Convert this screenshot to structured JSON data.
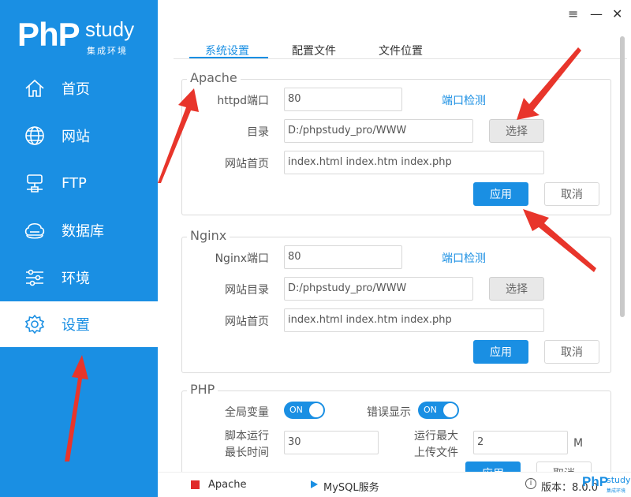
{
  "app": {
    "logo_php": "PhP",
    "logo_study": "study",
    "logo_tagline": "集成环境",
    "window_controls": {
      "menu": "≡",
      "minimize": "—",
      "close": "✕"
    }
  },
  "sidebar": {
    "items": [
      {
        "label": "首页",
        "icon": "home-icon"
      },
      {
        "label": "网站",
        "icon": "globe-icon"
      },
      {
        "label": "FTP",
        "icon": "ftp-icon"
      },
      {
        "label": "数据库",
        "icon": "database-icon"
      },
      {
        "label": "环境",
        "icon": "sliders-icon"
      },
      {
        "label": "设置",
        "icon": "gear-icon",
        "active": true
      }
    ]
  },
  "tabs": [
    "系统设置",
    "配置文件",
    "文件位置"
  ],
  "apache": {
    "title": "Apache",
    "port_label": "httpd端口",
    "port_value": "80",
    "port_check": "端口检测",
    "dir_label": "目录",
    "dir_value": "D:/phpstudy_pro/WWW",
    "choose": "选择",
    "index_label": "网站首页",
    "index_value": "index.html index.htm index.php",
    "apply": "应用",
    "cancel": "取消"
  },
  "nginx": {
    "title": "Nginx",
    "port_label": "Nginx端口",
    "port_value": "80",
    "port_check": "端口检测",
    "dir_label": "网站目录",
    "dir_value": "D:/phpstudy_pro/WWW",
    "choose": "选择",
    "index_label": "网站首页",
    "index_value": "index.html index.htm index.php",
    "apply": "应用",
    "cancel": "取消"
  },
  "php": {
    "title": "PHP",
    "global_vars_label": "全局变量",
    "global_vars_toggle": "ON",
    "error_display_label": "错误显示",
    "error_display_toggle": "ON",
    "max_exec_label_1": "脚本运行",
    "max_exec_label_2": "最长时间",
    "max_exec_value": "30",
    "max_upload_label_1": "运行最大",
    "max_upload_label_2": "上传文件",
    "max_upload_value": "2",
    "max_upload_unit": "M",
    "apply": "应用",
    "cancel": "取消"
  },
  "statusbar": {
    "apache": "Apache",
    "mysql": "MySQL服务",
    "version": "版本：8.0.0",
    "logo_php": "PhP",
    "logo_study": "study",
    "logo_tagline": "集成环境"
  },
  "colors": {
    "accent": "#1a8fe3",
    "annotation_arrow": "#e8352b"
  }
}
